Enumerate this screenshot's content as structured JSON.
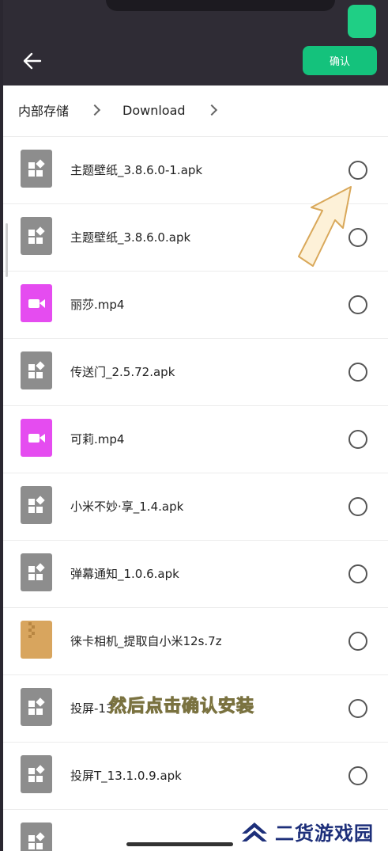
{
  "header": {
    "confirm_label": "确认",
    "back_icon": "arrow-left-icon"
  },
  "breadcrumb": {
    "items": [
      "内部存储",
      "Download"
    ]
  },
  "files": [
    {
      "name": "主题壁纸_3.8.6.0-1.apk",
      "type": "apk"
    },
    {
      "name": "主题壁纸_3.8.6.0.apk",
      "type": "apk"
    },
    {
      "name": "丽莎.mp4",
      "type": "video"
    },
    {
      "name": "传送门_2.5.72.apk",
      "type": "apk"
    },
    {
      "name": "可莉.mp4",
      "type": "video"
    },
    {
      "name": "小米不妙·享_1.4.apk",
      "type": "apk"
    },
    {
      "name": "弹幕通知_1.0.6.apk",
      "type": "apk"
    },
    {
      "name": "徕卡相机_提取自小米12s.7z",
      "type": "zip"
    },
    {
      "name": "投屏-13",
      "type": "apk"
    },
    {
      "name": "投屏T_13.1.0.9.apk",
      "type": "apk"
    },
    {
      "name": "",
      "type": "apk"
    }
  ],
  "overlay": {
    "caption": "然后点击确认安装",
    "watermark": "二货游戏园"
  },
  "colors": {
    "accent": "#14c27c",
    "apk_icon": "#8d8d8d",
    "video_icon": "#e54cf0",
    "zip_icon": "#d8a55e"
  }
}
